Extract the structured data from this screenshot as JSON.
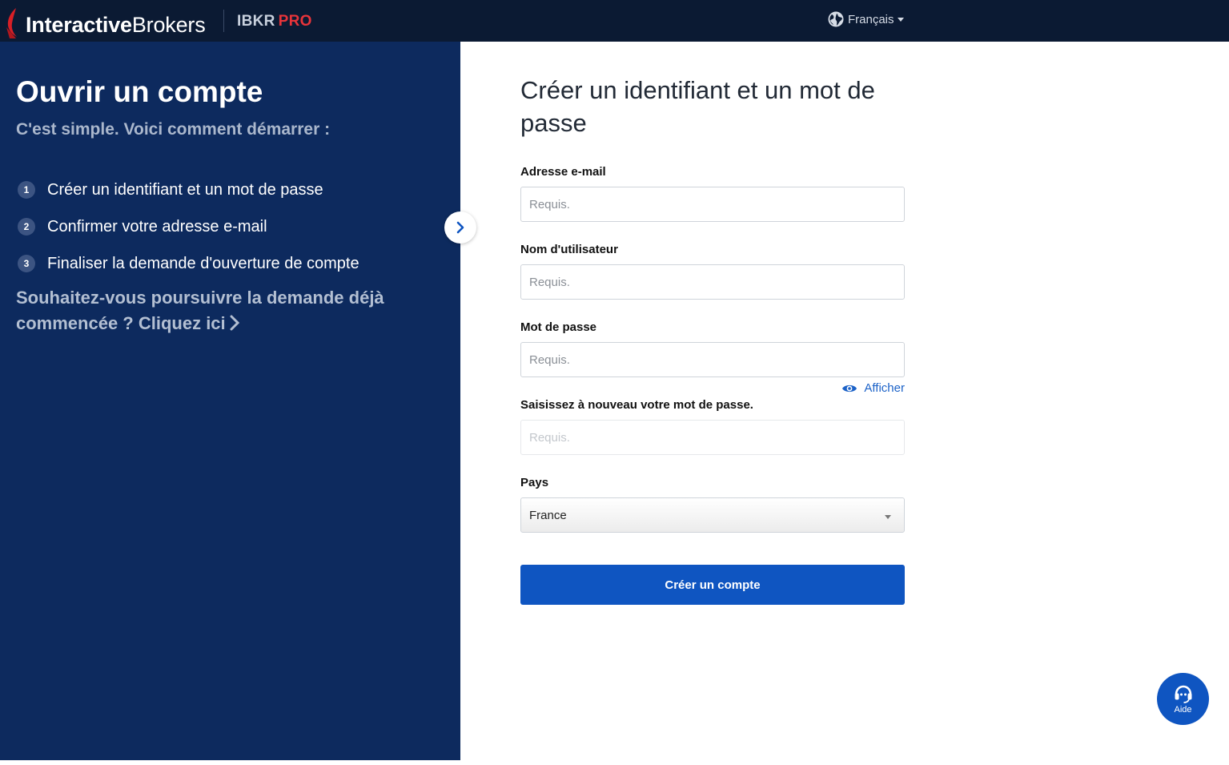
{
  "header": {
    "brand_bold": "Interactive",
    "brand_light": "Brokers",
    "product": "IBKR",
    "product_tier": "PRO",
    "language": "Français",
    "colors": {
      "bar": "#0b1a33",
      "pro": "#e8343a",
      "logo_mark": "#d81f26"
    }
  },
  "sidebar": {
    "title": "Ouvrir un compte",
    "subtitle": "C'est simple. Voici comment démarrer :",
    "steps": [
      {
        "num": "1",
        "label": "Créer un identifiant et un mot de passe"
      },
      {
        "num": "2",
        "label": "Confirmer votre adresse e-mail"
      },
      {
        "num": "3",
        "label": "Finaliser la demande d'ouverture de compte"
      }
    ],
    "resume_text": "Souhaitez-vous poursuivre la demande déjà commencée ?",
    "resume_link": "Cliquez ici",
    "background": "#0d2a5e"
  },
  "form": {
    "heading": "Créer un identifiant et un mot de passe",
    "email": {
      "label": "Adresse e-mail",
      "placeholder": "Requis.",
      "value": ""
    },
    "username": {
      "label": "Nom d'utilisateur",
      "placeholder": "Requis.",
      "value": ""
    },
    "password": {
      "label": "Mot de passe",
      "placeholder": "Requis.",
      "value": ""
    },
    "show_password": "Afficher",
    "confirm_password": {
      "label": "Saisissez à nouveau votre mot de passe.",
      "placeholder": "Requis.",
      "value": ""
    },
    "country": {
      "label": "Pays",
      "selected": "France"
    },
    "submit": "Créer un compte",
    "accent": "#0f55c1"
  },
  "help": {
    "label": "Aide"
  },
  "icons": [
    "logo-mark-icon",
    "globe-icon",
    "chevron-right-icon",
    "eye-icon",
    "headset-icon"
  ]
}
